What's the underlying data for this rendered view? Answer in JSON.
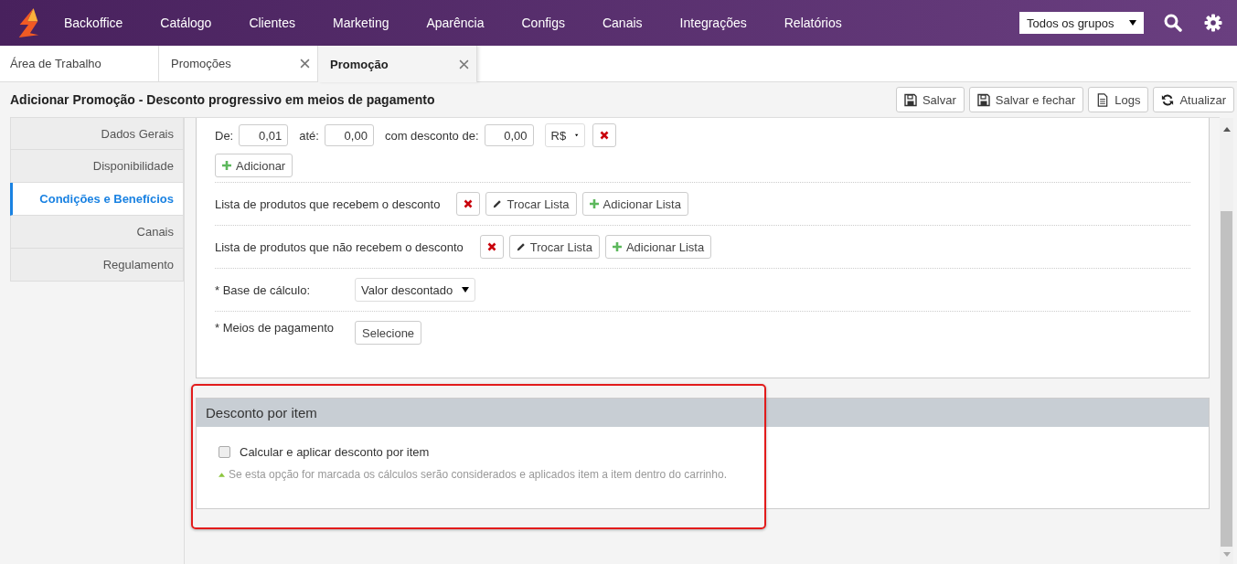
{
  "nav": {
    "items": [
      "Backoffice",
      "Catálogo",
      "Clientes",
      "Marketing",
      "Aparência",
      "Configs",
      "Canais",
      "Integrações",
      "Relatórios"
    ],
    "group_select": "Todos os grupos"
  },
  "tabs": [
    {
      "label": "Área de Trabalho",
      "selected": false,
      "closable": false
    },
    {
      "label": "Promoções",
      "selected": false,
      "closable": true
    },
    {
      "label": "Promoção",
      "selected": true,
      "closable": true
    }
  ],
  "page_title": "Adicionar Promoção - Desconto progressivo em meios de pagamento",
  "toolbar": [
    {
      "label": "Salvar",
      "kind": "save"
    },
    {
      "label": "Salvar e fechar",
      "kind": "save"
    },
    {
      "label": "Logs",
      "kind": "doc"
    },
    {
      "label": "Atualizar",
      "kind": "refresh"
    }
  ],
  "sidebar": [
    {
      "label": "Dados Gerais",
      "selected": false
    },
    {
      "label": "Disponibilidade",
      "selected": false
    },
    {
      "label": "Condições e Benefícios",
      "selected": true
    },
    {
      "label": "Canais",
      "selected": false
    },
    {
      "label": "Regulamento",
      "selected": false
    }
  ],
  "range_row": {
    "from_label": "De:",
    "from_value": "0,01",
    "to_label": "até:",
    "to_value": "0,00",
    "discount_label": "com desconto de:",
    "discount_value": "0,00",
    "unit": "R$"
  },
  "add_button": "Adicionar",
  "product_lists": [
    {
      "label": "Lista de produtos que recebem o desconto",
      "change_button": "Trocar Lista",
      "add_button": "Adicionar Lista"
    },
    {
      "label": "Lista de produtos que não recebem o desconto",
      "change_button": "Trocar Lista",
      "add_button": "Adicionar Lista"
    }
  ],
  "base_calculo": {
    "label": "* Base de cálculo:",
    "value": "Valor descontado"
  },
  "meios_pagamento": {
    "label": "* Meios de pagamento",
    "button": "Selecione"
  },
  "item_section": {
    "title": "Desconto por item",
    "checkbox_label": "Calcular e aplicar desconto por item",
    "checked": false,
    "hint": "Se esta opção for marcada os cálculos serão considerados e aplicados item a item dentro do carrinho."
  }
}
